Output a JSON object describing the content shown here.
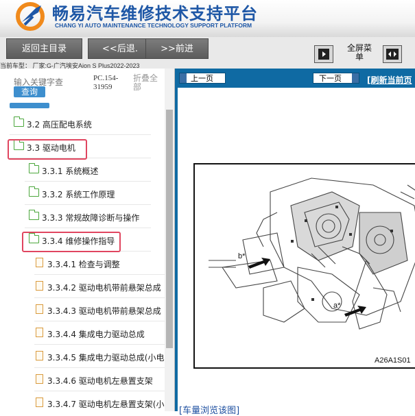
{
  "header": {
    "title_cn": "畅易汽车维修技术支持平台",
    "title_en": "CHANG YI AUTO MAINTENANCE TECHNOLOGY SUPPORT PLATFORM"
  },
  "toolbar": {
    "back_main": "返回主目录",
    "back": "<<后退.",
    "forward": ">>前进",
    "full_menu": "全屏菜单",
    "vehicle": "当前车型： 厂家:G-广汽埃安Aion S Plus2022-2023"
  },
  "sidebar": {
    "search_placeholder": "输入关键字查",
    "search_button": "查询",
    "pc_code": "PC.154-31959",
    "collapse_all": "折叠全部",
    "items": [
      {
        "label": "3.2 高压配电系统",
        "type": "folder",
        "level": 1
      },
      {
        "label": "3.3 驱动电机",
        "type": "folder",
        "level": 1,
        "highlighted": true
      },
      {
        "label": "3.3.1 系统概述",
        "type": "folder",
        "level": 2
      },
      {
        "label": "3.3.2 系统工作原理",
        "type": "folder",
        "level": 2
      },
      {
        "label": "3.3.3 常规故障诊断与操作",
        "type": "folder",
        "level": 2
      },
      {
        "label": "3.3.4 维修操作指导",
        "type": "folder",
        "level": 2,
        "highlighted": true
      },
      {
        "label": "3.3.4.1 检查与调整",
        "type": "doc",
        "level": 3
      },
      {
        "label": "3.3.4.2 驱动电机带前悬架总成",
        "type": "doc",
        "level": 3
      },
      {
        "label": "3.3.4.3 驱动电机带前悬架总成",
        "type": "doc",
        "level": 3
      },
      {
        "label": "3.3.4.4 集成电力驱动总成",
        "type": "doc",
        "level": 3
      },
      {
        "label": "3.3.4.5 集成电力驱动总成(小电",
        "type": "doc",
        "level": 3
      },
      {
        "label": "3.3.4.6 驱动电机左悬置支架",
        "type": "doc",
        "level": 3
      },
      {
        "label": "3.3.4.7 驱动电机左悬置支架(小",
        "type": "doc",
        "level": 3
      }
    ]
  },
  "content": {
    "prev_page": "上一页",
    "next_page": "下一页",
    "refresh": "[刷新当前页",
    "figure_label_b": "b*",
    "figure_label_a": "a*",
    "figure_code": "A26A1S01",
    "bottom_link": "[车量浏览该图]"
  },
  "colors": {
    "brand_blue": "#1e57a6",
    "nav_blue": "#0f6aa3",
    "highlight_red": "#e0455f",
    "folder_green": "#4aa63b",
    "doc_orange": "#d99a3c"
  }
}
